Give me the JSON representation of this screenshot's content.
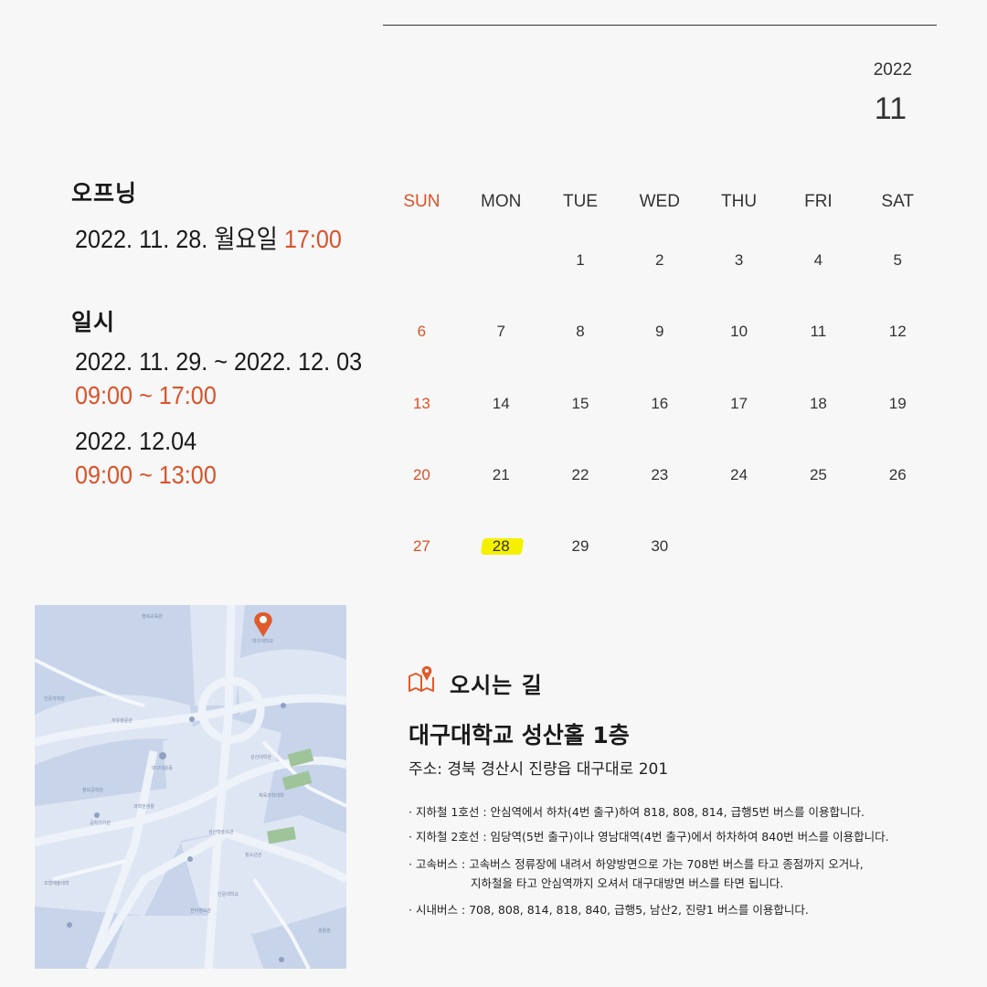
{
  "header": {
    "year": "2022",
    "month": "11"
  },
  "opening": {
    "label": "오프닝",
    "date": "2022. 11. 28. 월요일 ",
    "time": "17:00"
  },
  "schedule": {
    "label": "일시",
    "period1": {
      "dates": "2022. 11. 29. ~ 2022. 12. 03",
      "time": "09:00 ~ 17:00"
    },
    "period2": {
      "dates": "2022. 12.04",
      "time": "09:00 ~ 13:00"
    }
  },
  "calendar": {
    "weekdays": [
      "SUN",
      "MON",
      "TUE",
      "WED",
      "THU",
      "FRI",
      "SAT"
    ],
    "weeks": [
      [
        "",
        "",
        "1",
        "2",
        "3",
        "4",
        "5"
      ],
      [
        "6",
        "7",
        "8",
        "9",
        "10",
        "11",
        "12"
      ],
      [
        "13",
        "14",
        "15",
        "16",
        "17",
        "18",
        "19"
      ],
      [
        "20",
        "21",
        "22",
        "23",
        "24",
        "25",
        "26"
      ],
      [
        "27",
        "28",
        "29",
        "30",
        "",
        "",
        ""
      ]
    ],
    "highlighted_day": "28",
    "accent_color": "#d9532b",
    "highlight_color": "#f5f000"
  },
  "map": {
    "icon": "map-pin-icon",
    "pin_color": "#e05a2b"
  },
  "directions": {
    "icon": "map-book-icon",
    "title": "오시는 길",
    "place": "대구대학교 성산홀 1층",
    "address": "주소: 경북 경산시 진량읍 대구대로 201",
    "lines": [
      "· 지하철 1호선 : 안심역에서 하차(4번 출구)하여 818, 808, 814, 급행5번 버스를 이용합니다.",
      "· 지하철 2호선 : 임당역(5번 출구)이나 영남대역(4번 출구)에서 하차하여 840번 버스를 이용합니다.",
      "· 고속버스 : 고속버스 정류장에 내려서 하양방면으로 가는 708번 버스를 타고 종점까지 오거나,",
      "지하철을 타고 안심역까지 오셔서 대구대방면 버스를 타면 됩니다.",
      "· 시내버스 : 708, 808, 814, 818, 840, 급행5, 남산2, 진량1 버스를 이용합니다."
    ]
  }
}
